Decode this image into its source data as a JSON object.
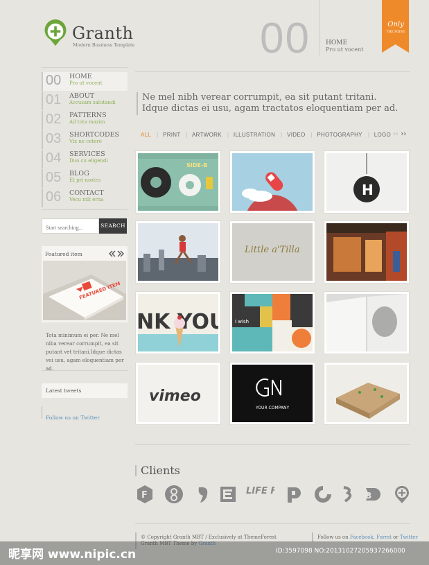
{
  "brand": {
    "name": "Granth",
    "tagline": "Modern Business Template"
  },
  "header": {
    "big_number": "00",
    "page_title": "HOME",
    "page_subtitle": "Pro ut vocent"
  },
  "ribbon": {
    "line1": "Only",
    "line2": "THE POINT"
  },
  "nav": [
    {
      "num": "00",
      "label": "HOME",
      "sub": "Pro ut vocent",
      "active": true
    },
    {
      "num": "01",
      "label": "ABOUT",
      "sub": "Accusam salutandi"
    },
    {
      "num": "02",
      "label": "PATTERNS",
      "sub": "Ad tota mazim"
    },
    {
      "num": "03",
      "label": "SHORTCODES",
      "sub": "Vix ne cetero"
    },
    {
      "num": "04",
      "label": "SERVICES",
      "sub": "Duo cu eligendi"
    },
    {
      "num": "05",
      "label": "BLOG",
      "sub": "Et pri nostro"
    },
    {
      "num": "06",
      "label": "CONTACT",
      "sub": "Vecu mit erna"
    }
  ],
  "search": {
    "placeholder": "Start searching...",
    "button": "SEARCH"
  },
  "featured": {
    "title": "Featured item",
    "arrows": "‹ ›",
    "image_text": "FEATURED ITEM",
    "text": "Tota minimum ei per. Ne mel niba verear corrumpit, ea sit putant vet tritani.Idque dictas vei usu, agam eloquentiam per ad."
  },
  "tweets": {
    "title": "Latest tweets",
    "follow": "Follow us on Twitter"
  },
  "intro": "Ne mel nibh verear corrumpit, ea sit putant tritani. Idque dictas ei usu, agam tractatos eloquentiam per ad.",
  "filters": [
    "ALL",
    "PRINT",
    "ARTWORK",
    "ILLUSTRATION",
    "VIDEO",
    "PHOTOGRAPHY",
    "LOGO"
  ],
  "pager": {
    "prev": "‹‹",
    "next": "››"
  },
  "portfolio": [
    {
      "label": "SIDE-B"
    },
    {
      "label": ""
    },
    {
      "label": "H"
    },
    {
      "label": ""
    },
    {
      "label": "Little a'Tilla"
    },
    {
      "label": ""
    },
    {
      "label": "NK YOU."
    },
    {
      "label": "I wish"
    },
    {
      "label": ""
    },
    {
      "label": "vimeo"
    },
    {
      "label": "YOUR COMPANY"
    },
    {
      "label": ""
    }
  ],
  "clients": {
    "title": "Clients",
    "logo5": "LIFE FILM"
  },
  "footer": {
    "copyright": "© Copyright Granth MBT / Exclusively at ThemeForest",
    "theme_by_prefix": "Granth MBT Theme by",
    "theme_by_link": "Granth",
    "follow_prefix": "Follow us on",
    "facebook": "Facebook",
    "forrst": "Forrst",
    "or": "or",
    "twitter": "Twitter"
  },
  "watermark": {
    "left": "昵享网 www.nipic.cn",
    "right": "ID:3597098 NO:20131027205937266000"
  }
}
